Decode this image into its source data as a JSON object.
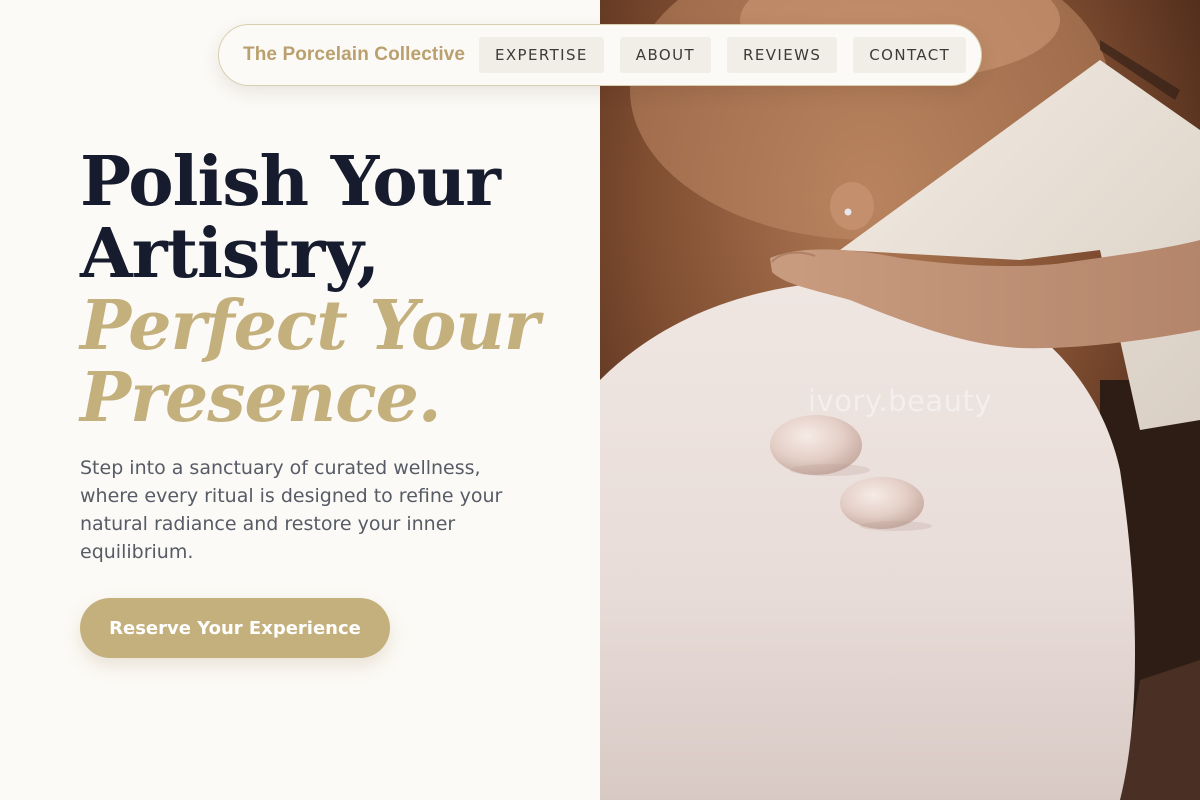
{
  "nav": {
    "brand": "The Porcelain Collective",
    "links": [
      {
        "label": "EXPERTISE"
      },
      {
        "label": "ABOUT"
      },
      {
        "label": "REVIEWS"
      },
      {
        "label": "CONTACT"
      }
    ]
  },
  "hero": {
    "headline_line1": "Polish Your",
    "headline_line2": "Artistry,",
    "headline_accent1": "Perfect Your",
    "headline_accent2": "Presence.",
    "description": "Step into a sanctuary of curated wellness, where every ritual is designed to refine your natural radiance and restore your inner equilibrium.",
    "cta_label": "Reserve Your Experience"
  },
  "photo": {
    "watermark": "ivory.beauty"
  },
  "colors": {
    "background": "#fcfaf6",
    "accent_gold": "#c4b07c",
    "headline_navy": "#161b2e",
    "body_gray": "#565b66"
  }
}
